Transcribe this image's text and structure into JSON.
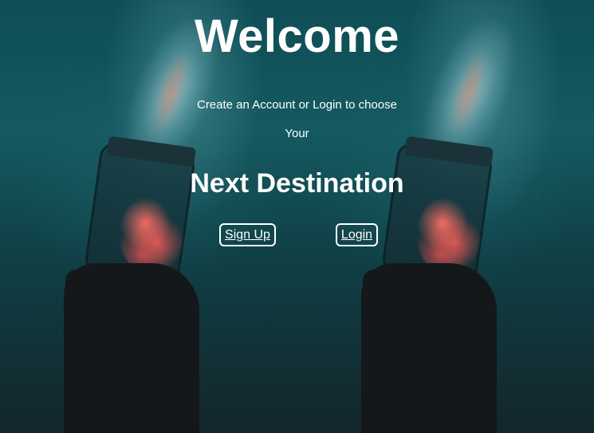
{
  "hero": {
    "title": "Welcome",
    "subtitle_line1": "Create an Account or Login to choose",
    "subtitle_line2": "Your",
    "headline": "Next Destination"
  },
  "actions": {
    "signup_label": "Sign Up",
    "login_label": "Login"
  },
  "colors": {
    "text": "#ffffff",
    "background_teal": "#145a60",
    "background_dark": "#13262b",
    "nebula_red": "#f05a55"
  }
}
